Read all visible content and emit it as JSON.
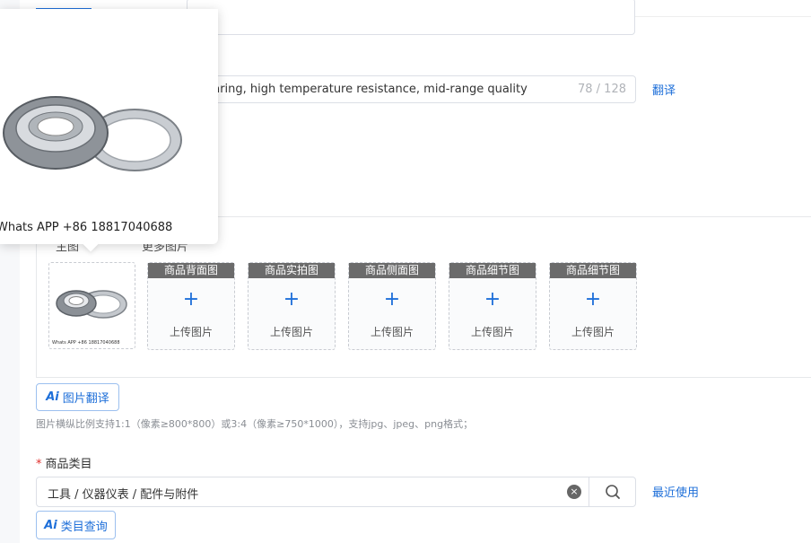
{
  "title_field": {
    "value_visible": "bearing, high temperature resistance, mid-range quality",
    "char_count": "78 / 128",
    "translate_label": "翻译"
  },
  "images": {
    "tabs": [
      "主图",
      "更多图片"
    ],
    "main_image_caption": "Whats APP +86 18817040688",
    "slots": [
      {
        "header": "商品背面图",
        "upload_label": "上传图片"
      },
      {
        "header": "商品实拍图",
        "upload_label": "上传图片"
      },
      {
        "header": "商品侧面图",
        "upload_label": "上传图片"
      },
      {
        "header": "商品细节图",
        "upload_label": "上传图片"
      },
      {
        "header": "商品细节图",
        "upload_label": "上传图片"
      }
    ],
    "plus_glyph": "+",
    "ai_translate": {
      "mark": "Ai",
      "label": "图片翻译"
    },
    "hint": "图片横纵比例支持1:1（像素≥800*800）或3:4（像素≥750*1000），支持jpg、jpeg、png格式；"
  },
  "category": {
    "required_mark": "*",
    "label": "商品类目",
    "value": "工具 / 仪器仪表 / 配件与附件",
    "recent_label": "最近使用",
    "ai_query": {
      "mark": "Ai",
      "label": "类目查询"
    }
  },
  "popover": {
    "caption": "Whats APP +86 18817040688"
  },
  "colors": {
    "accent": "#1e6fd9",
    "slot_header": "#6b6b6b",
    "required": "#e0302e"
  }
}
